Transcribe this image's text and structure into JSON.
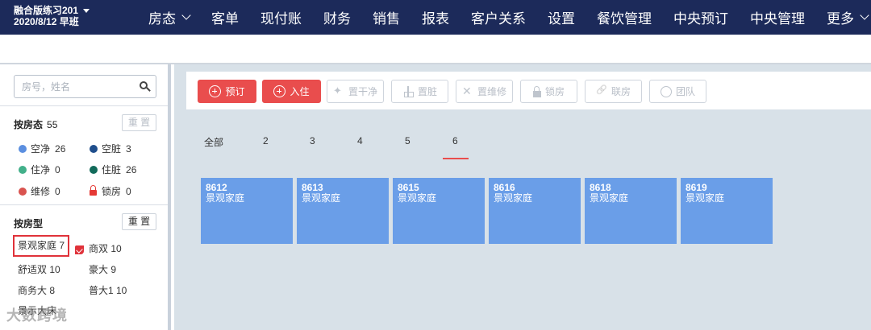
{
  "brand": {
    "name": "融合版练习201",
    "date_shift": "2020/8/12 早班"
  },
  "nav": {
    "items": [
      {
        "label": "房态",
        "has_chevron": true
      },
      {
        "label": "客单",
        "has_chevron": false
      },
      {
        "label": "现付账",
        "has_chevron": false
      },
      {
        "label": "财务",
        "has_chevron": false
      },
      {
        "label": "销售",
        "has_chevron": false
      },
      {
        "label": "报表",
        "has_chevron": false
      },
      {
        "label": "客户关系",
        "has_chevron": false
      },
      {
        "label": "设置",
        "has_chevron": false
      },
      {
        "label": "餐饮管理",
        "has_chevron": false
      },
      {
        "label": "中央预订",
        "has_chevron": false
      },
      {
        "label": "中央管理",
        "has_chevron": false
      },
      {
        "label": "更多",
        "has_chevron": true
      }
    ]
  },
  "sidebar": {
    "search": {
      "placeholder": "房号，姓名",
      "value": ""
    },
    "by_status": {
      "title": "按房态",
      "count": "55",
      "reset_label": "重 置",
      "items": [
        {
          "label": "空净",
          "count": "26",
          "color": "#5b8fe0",
          "icon": "dot"
        },
        {
          "label": "空脏",
          "count": "3",
          "color": "#1f4e8c",
          "icon": "dot"
        },
        {
          "label": "住净",
          "count": "0",
          "color": "#42b08a",
          "icon": "dot"
        },
        {
          "label": "住脏",
          "count": "26",
          "color": "#116a5a",
          "icon": "dot"
        },
        {
          "label": "维修",
          "count": "0",
          "color": "#d9534f",
          "icon": "dot"
        },
        {
          "label": "锁房",
          "count": "0",
          "color": "#e53935",
          "icon": "lock-icon"
        }
      ]
    },
    "by_type": {
      "title": "按房型",
      "reset_label": "重 置",
      "items": [
        {
          "label": "景观家庭 7",
          "selected": true
        },
        {
          "label": "商双 10",
          "selected": false
        },
        {
          "label": "舒适双 10",
          "selected": false
        },
        {
          "label": "豪大 9",
          "selected": false
        },
        {
          "label": "商务大 8",
          "selected": false
        },
        {
          "label": "普大1 10",
          "selected": false
        },
        {
          "label": "景示大床",
          "selected": false
        }
      ]
    }
  },
  "toolbar": {
    "buttons": [
      {
        "label": "预订",
        "style": "primary",
        "icon": "circle-plus-icon"
      },
      {
        "label": "入住",
        "style": "primary",
        "icon": "circle-plus-icon"
      },
      {
        "label": "置干净",
        "style": "disabled",
        "icon": "sparkle-icon"
      },
      {
        "label": "置脏",
        "style": "disabled",
        "icon": "broom-icon"
      },
      {
        "label": "置维修",
        "style": "disabled",
        "icon": "tools-icon"
      },
      {
        "label": "锁房",
        "style": "disabled",
        "icon": "padlock-icon"
      },
      {
        "label": "联房",
        "style": "disabled",
        "icon": "link-icon"
      },
      {
        "label": "团队",
        "style": "disabled",
        "icon": "team-icon"
      }
    ]
  },
  "floors": {
    "tabs": [
      "全部",
      "2",
      "3",
      "4",
      "5",
      "6"
    ],
    "active_index": 5
  },
  "rooms": [
    {
      "number": "8612",
      "type": "景观家庭"
    },
    {
      "number": "8613",
      "type": "景观家庭"
    },
    {
      "number": "8615",
      "type": "景观家庭"
    },
    {
      "number": "8616",
      "type": "景观家庭"
    },
    {
      "number": "8618",
      "type": "景观家庭"
    },
    {
      "number": "8619",
      "type": "景观家庭"
    }
  ],
  "watermark": "大数跨境",
  "colors": {
    "nav_bg": "#1c2a5a",
    "accent": "#e94d4d",
    "room_tile": "#6a9ee8",
    "main_bg": "#d8e1e8"
  }
}
